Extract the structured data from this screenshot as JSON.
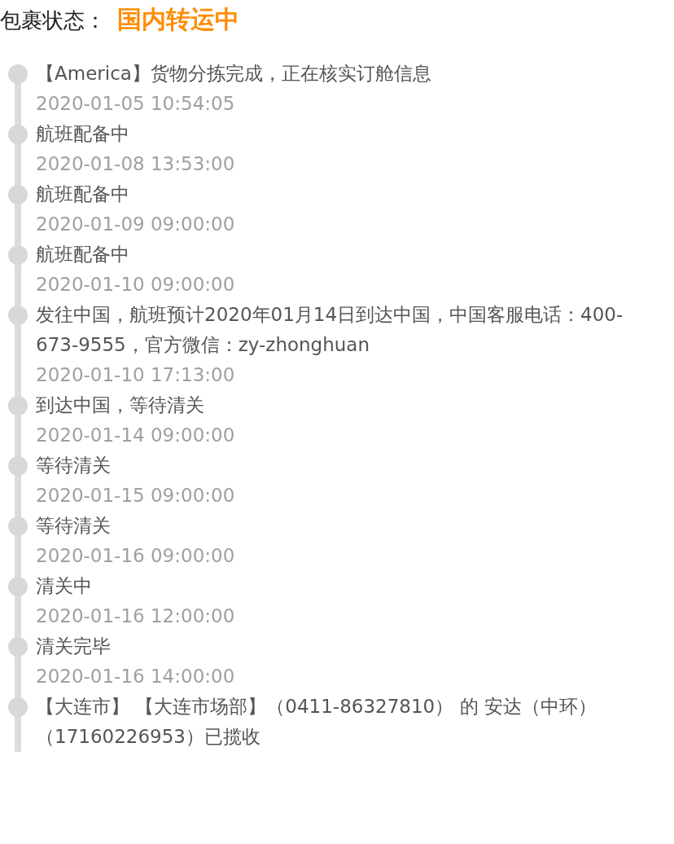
{
  "status": {
    "label": "包裹状态：",
    "value": "国内转运中"
  },
  "events": [
    {
      "text": "【America】货物分拣完成，正在核实订舱信息",
      "time": "2020-01-05 10:54:05"
    },
    {
      "text": "航班配备中",
      "time": "2020-01-08 13:53:00"
    },
    {
      "text": "航班配备中",
      "time": "2020-01-09 09:00:00"
    },
    {
      "text": "航班配备中",
      "time": "2020-01-10 09:00:00"
    },
    {
      "text": "发往中国，航班预计2020年01月14日到达中国，中国客服电话：400-673-9555，官方微信：zy-zhonghuan",
      "time": "2020-01-10 17:13:00"
    },
    {
      "text": "到达中国，等待清关",
      "time": "2020-01-14 09:00:00"
    },
    {
      "text": "等待清关",
      "time": "2020-01-15 09:00:00"
    },
    {
      "text": "等待清关",
      "time": "2020-01-16 09:00:00"
    },
    {
      "text": "清关中",
      "time": "2020-01-16 12:00:00"
    },
    {
      "text": "清关完毕",
      "time": "2020-01-16 14:00:00"
    },
    {
      "text": "【大连市】 【大连市场部】（0411-86327810） 的 安达（中环）（17160226953）已揽收"
    }
  ]
}
